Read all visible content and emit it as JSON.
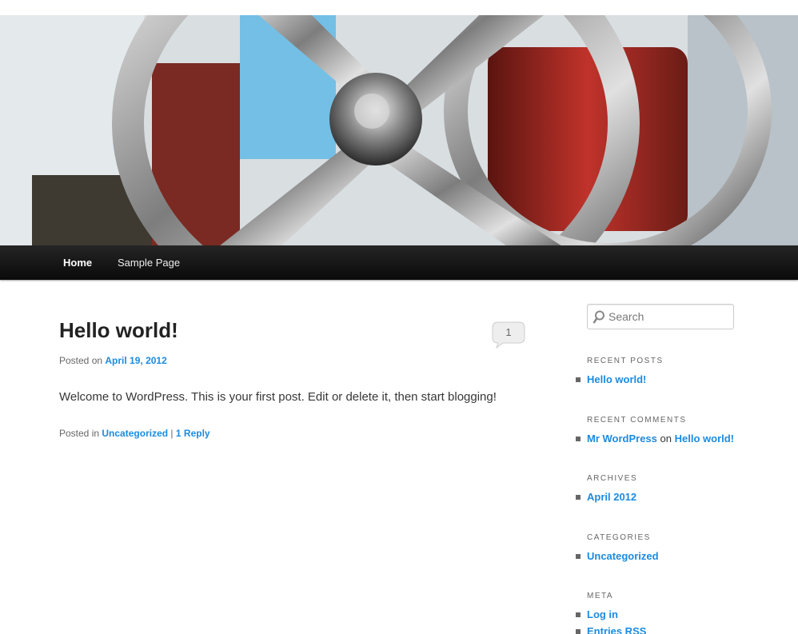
{
  "nav": {
    "items": [
      "Home",
      "Sample Page"
    ]
  },
  "post": {
    "title": "Hello world!",
    "comment_count": "1",
    "posted_on_label": "Posted on",
    "date": "April 19, 2012",
    "content": "Welcome to WordPress. This is your first post. Edit or delete it, then start blogging!",
    "posted_in_label": "Posted in",
    "category": "Uncategorized",
    "separator": "|",
    "reply_link": "1 Reply"
  },
  "sidebar": {
    "search_placeholder": "Search",
    "recent_posts_title": "Recent Posts",
    "recent_posts": [
      "Hello world!"
    ],
    "recent_comments_title": "Recent Comments",
    "recent_comment": {
      "author": "Mr WordPress",
      "on": "on",
      "post": "Hello world!"
    },
    "archives_title": "Archives",
    "archives": [
      "April 2012"
    ],
    "categories_title": "Categories",
    "categories": [
      "Uncategorized"
    ],
    "meta_title": "Meta",
    "meta_links": [
      "Log in",
      "Entries RSS"
    ]
  },
  "colors": {
    "link": "#1b8be0",
    "nav_bg": "#111111"
  },
  "icons": [
    "search-icon",
    "comment-bubble-icon"
  ]
}
